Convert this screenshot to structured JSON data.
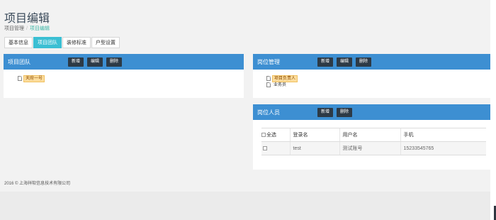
{
  "header": {
    "title": "项目编辑",
    "breadcrumb": {
      "parent": "项目管理",
      "separator": "/",
      "current": "项目编辑"
    }
  },
  "tabs": [
    {
      "label": "基本信息",
      "active": false
    },
    {
      "label": "项目团队",
      "active": true
    },
    {
      "label": "装修标准",
      "active": false
    },
    {
      "label": "户型设置",
      "active": false
    }
  ],
  "team_panel": {
    "title": "项目团队",
    "buttons": {
      "add": "新增",
      "edit": "编辑",
      "delete": "删除"
    },
    "tree": [
      {
        "label": "天府一号",
        "icon": "document-icon",
        "selected": true
      }
    ]
  },
  "post_panel": {
    "title": "岗位管理",
    "buttons": {
      "add": "新增",
      "edit": "编辑",
      "delete": "删除"
    },
    "tree": [
      {
        "label": "项目负责人",
        "icon": "document-icon",
        "selected": true
      },
      {
        "label": "业务员",
        "icon": "document-icon",
        "selected": false
      }
    ]
  },
  "staff_panel": {
    "title": "岗位人员",
    "buttons": {
      "add": "新增",
      "delete": "删除"
    },
    "table": {
      "headers": {
        "select_all": "全选",
        "login": "登录名",
        "username": "用户名",
        "phone": "手机"
      },
      "rows": [
        {
          "login": "test",
          "username": "测试账号",
          "phone": "15233545765"
        }
      ]
    }
  },
  "footer": {
    "copyright": "2016 © 上海祥软信息技术有限公司"
  },
  "colors": {
    "panel_header": "#3d8fd2",
    "tab_active": "#3bbfd3",
    "button": "#2d3a46",
    "breadcrumb_active": "#3cb6a6",
    "tree_selected": "#fcdd9d"
  }
}
